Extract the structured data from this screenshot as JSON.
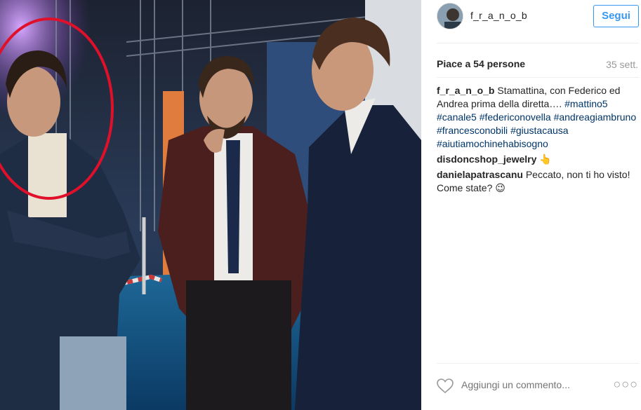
{
  "header": {
    "username": "f_r_a_n_o_b",
    "follow_label": "Segui"
  },
  "stats": {
    "likes": "Piace a 54 persone",
    "time": "35 sett."
  },
  "caption": {
    "user": "f_r_a_n_o_b",
    "text": " Stamattina, con Federico ed Andrea prima della diretta…. ",
    "hashtags": [
      "#mattino5",
      "#canale5",
      "#federiconovella",
      "#andreagiambruno",
      "#francesconobili",
      "#giustacausa",
      "#aiutiamochinehabisogno"
    ]
  },
  "comments": [
    {
      "user": "disdoncshop_jewelry",
      "text": " 👆"
    },
    {
      "user": "danielapatrascanu",
      "text": " Peccato, non ti ho visto! Come state? 😉"
    }
  ],
  "footer": {
    "add_comment_placeholder": "Aggiungi un commento...",
    "more": "○○○",
    "like_icon": "heart-icon"
  },
  "colors": {
    "link": "#003569",
    "follow": "#3897f0",
    "annotation_circle": "#e0102a"
  }
}
